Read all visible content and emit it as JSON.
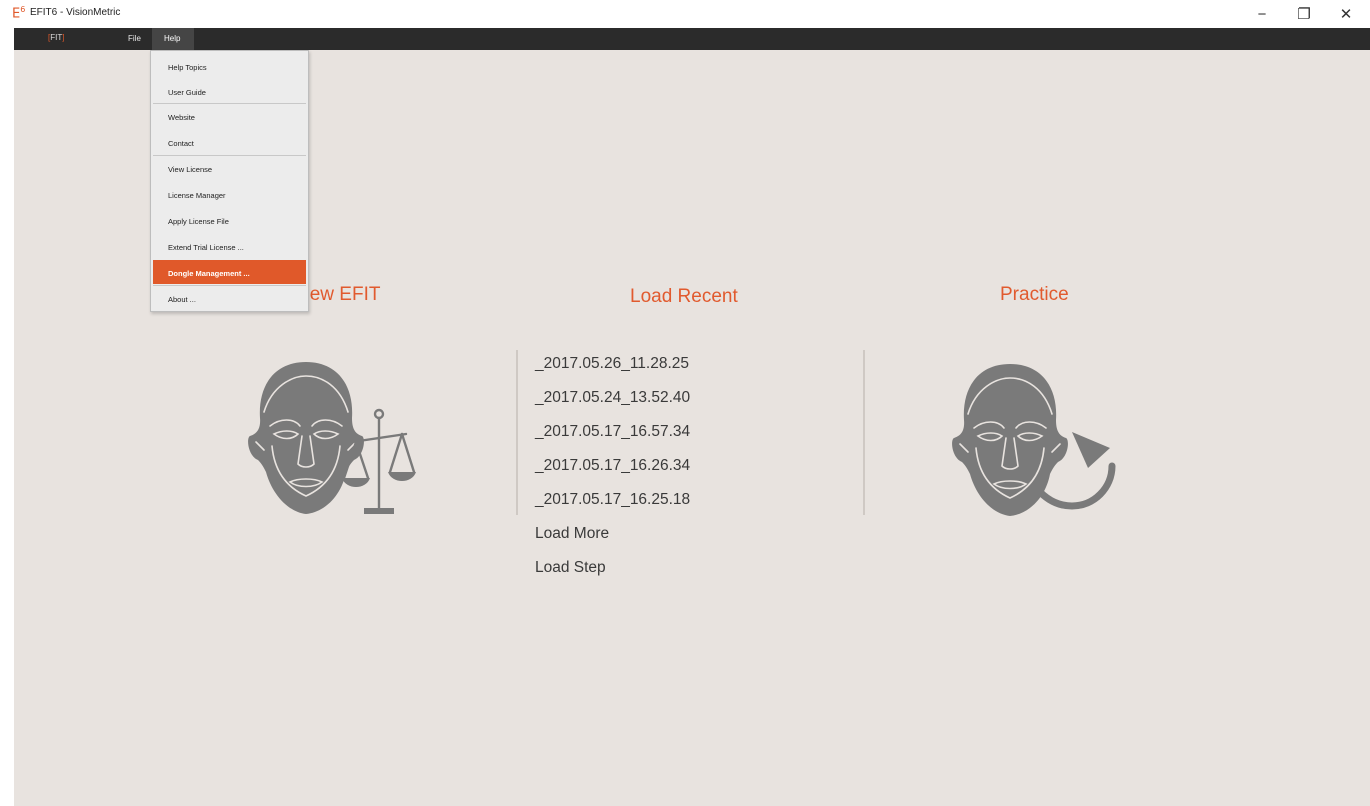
{
  "window": {
    "app_icon_letter": "E",
    "app_icon_superscript": "6",
    "title": "EFIT6 - VisionMetric",
    "minimize_glyph": "−",
    "maximize_glyph": "❐",
    "close_glyph": "✕"
  },
  "menubar": {
    "logo_open": "[",
    "logo_text": "FIT",
    "logo_close": "]",
    "file_label": "File",
    "help_label": "Help"
  },
  "help_menu": {
    "items": [
      {
        "label": "Help Topics"
      },
      {
        "label": "User Guide"
      },
      {
        "label": "Website"
      },
      {
        "label": "Contact"
      },
      {
        "label": "View License"
      },
      {
        "label": "License Manager"
      },
      {
        "label": "Apply License File"
      },
      {
        "label": "Extend Trial License ..."
      },
      {
        "label": "Dongle Management ..."
      },
      {
        "label": "About ..."
      }
    ],
    "highlighted": "Dongle Management ..."
  },
  "main": {
    "new_efit_title": "New EFIT",
    "load_recent_title": "Load Recent",
    "practice_title": "Practice",
    "recent_files": [
      "_2017.05.26_11.28.25",
      "_2017.05.24_13.52.40",
      "_2017.05.17_16.57.34",
      "_2017.05.17_16.26.34",
      "_2017.05.17_16.25.18"
    ],
    "load_more_label": "Load More",
    "load_step_label": "Load Step"
  },
  "colors": {
    "accent": "#e0592a",
    "background": "#e8e3df",
    "menubar": "#2b2b2b",
    "icon_gray": "#7a7a7a"
  },
  "icons": {
    "new_efit": "face-with-scales-icon",
    "practice": "face-with-rotate-arrow-icon"
  }
}
